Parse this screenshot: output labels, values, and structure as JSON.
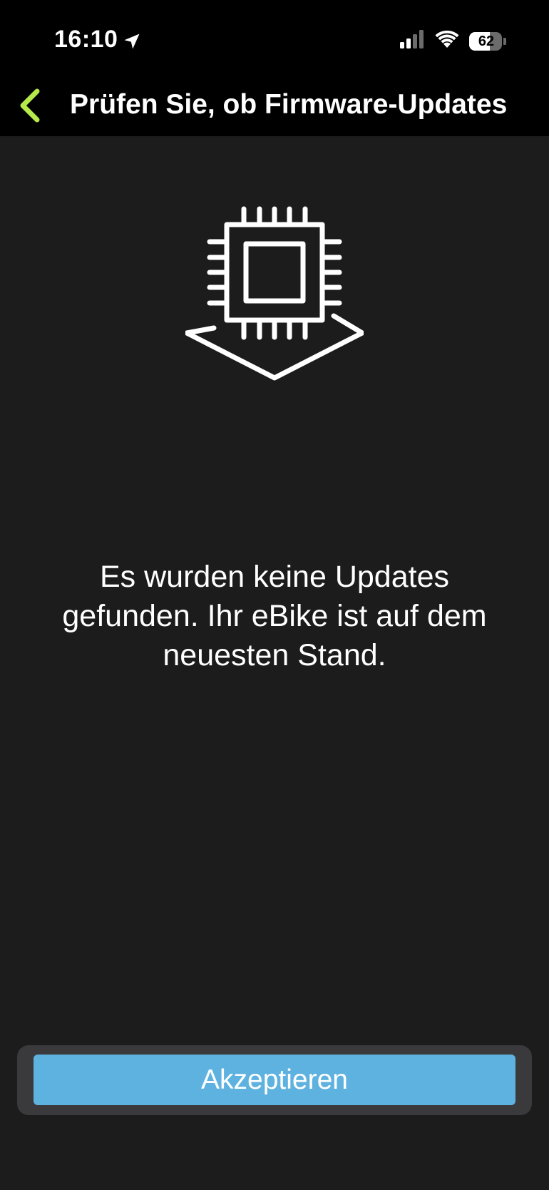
{
  "status_bar": {
    "time": "16:10",
    "battery_percent": "62",
    "battery_level": 0.62,
    "icons": [
      "location-arrow-icon",
      "cellular-signal-icon",
      "wifi-icon",
      "battery-icon"
    ]
  },
  "header": {
    "title": "Prüfen Sie, ob Firmware-Updates",
    "back_icon": "chevron-left-icon",
    "accent_color": "#b6e94a"
  },
  "main": {
    "illustration_icon": "firmware-chip-icon",
    "message": "Es wurden keine Updates gefunden. Ihr eBike ist auf dem neuesten Stand."
  },
  "footer": {
    "accept_label": "Akzeptieren",
    "button_color": "#5eb2e0"
  }
}
